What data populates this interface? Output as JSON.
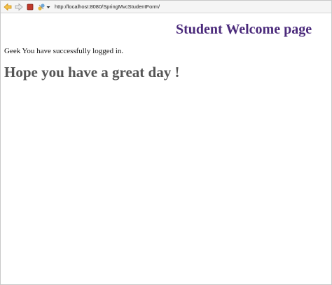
{
  "browser": {
    "url": "http://localhost:8080/SpringMvcStudentForm/",
    "icons": [
      "back-arrow-icon",
      "forward-arrow-icon",
      "stop-icon",
      "go-icon",
      "dropdown-arrow-icon"
    ],
    "colors": {
      "back_icon": "#e2a21a",
      "stop_icon": "#c0392b",
      "toolbar_bg": "#f5f5f5"
    }
  },
  "page": {
    "title": "Student Welcome page",
    "message": "Geek You have successfully logged in.",
    "greeting": "Hope you have a great day !",
    "colors": {
      "title": "#4b2a7b",
      "greeting": "#555555"
    }
  }
}
